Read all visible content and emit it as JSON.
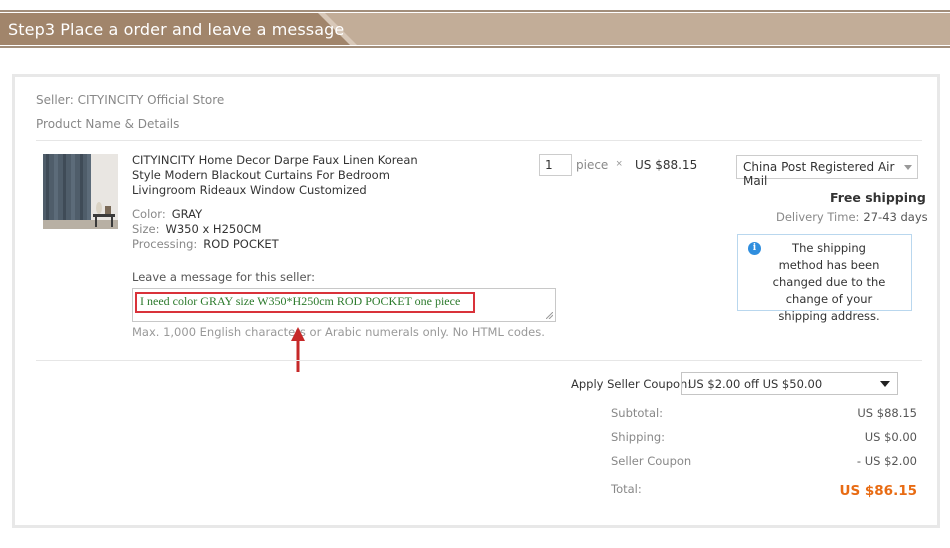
{
  "banner": {
    "title": "Step3   Place a order and leave a message",
    "colors": {
      "tab": "#a1856b",
      "band": "#c2ad98",
      "line": "#a28e7b"
    }
  },
  "order": {
    "seller": "Seller: CITYINCITY Official Store",
    "product_header": "Product Name & Details",
    "product": {
      "thumbnail_icon": "curtain-product-image",
      "title": "CITYINCITY Home Decor Darpe Faux Linen Korean Style Modern Blackout Curtains For Bedroom Livingroom Rideaux Window Customized",
      "attributes": [
        {
          "label": "Color:",
          "value": "GRAY"
        },
        {
          "label": "Size:",
          "value": "W350 x H250CM"
        },
        {
          "label": "Processing:",
          "value": "ROD POCKET"
        }
      ],
      "quantity": "1",
      "quantity_unit": "piece",
      "times_sign": "×",
      "unit_price": "US $88.15"
    },
    "shipping": {
      "method": "China Post Registered Air Mail",
      "free_shipping": "Free shipping",
      "delivery_label": "Delivery Time:",
      "delivery_value": "27-43 days",
      "notice_icon": "info-icon",
      "notice": "The shipping method has been changed due to the change of your shipping address."
    },
    "message": {
      "label": "Leave a message for this seller:",
      "value": "I need color GRAY size W350*H250cm ROD POCKET one piece",
      "hint": "Max. 1,000 English characters or Arabic numerals only. No HTML codes."
    },
    "coupon": {
      "label": "Apply Seller Coupon:",
      "selected": "US $2.00 off US $50.00"
    },
    "summary": [
      {
        "label": "Subtotal:",
        "value": "US $88.15"
      },
      {
        "label": "Shipping:",
        "value": "US $0.00"
      },
      {
        "label": "Seller Coupon",
        "value": "- US $2.00"
      }
    ],
    "total": {
      "label": "Total:",
      "value": "US $86.15"
    },
    "accent_colors": {
      "highlight": "#d9323a",
      "total": "#e86b13",
      "message_text": "#2c7a2c",
      "info": "#2f8ede"
    }
  }
}
